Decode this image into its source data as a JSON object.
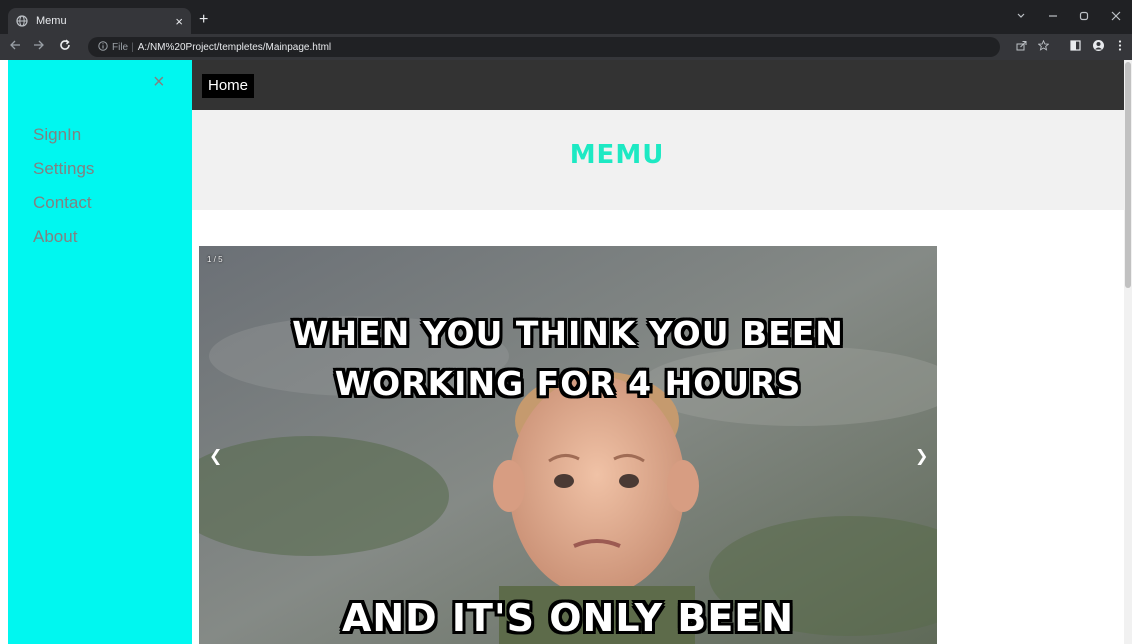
{
  "browser": {
    "tab_title": "Memu",
    "tab_close": "×",
    "new_tab": "+",
    "url_scheme": "File",
    "url_separator": "|",
    "url": "A:/NM%20Project/templetes/Mainpage.html",
    "icons": [
      "globe-icon",
      "back-icon",
      "forward-icon",
      "reload-icon",
      "info-icon",
      "share-icon",
      "star-icon",
      "sidepanel-icon",
      "profile-icon",
      "menu-icon",
      "tab-search-icon",
      "minimize-icon",
      "maximize-icon",
      "close-window-icon"
    ]
  },
  "sidebar": {
    "background": "#00f7f0",
    "close_label": "×",
    "items": [
      {
        "label": "SignIn"
      },
      {
        "label": "Settings"
      },
      {
        "label": "Contact"
      },
      {
        "label": "About"
      }
    ]
  },
  "topnav": {
    "home_label": "Home"
  },
  "header": {
    "title": "MEMU",
    "title_color": "#1de9c3"
  },
  "slideshow": {
    "counter": "1 / 5",
    "prev_label": "❮",
    "next_label": "❯",
    "meme": {
      "line1": "WHEN YOU THINK YOU BEEN",
      "line2": "WORKING FOR 4 HOURS",
      "line3": "AND IT'S ONLY BEEN"
    }
  }
}
